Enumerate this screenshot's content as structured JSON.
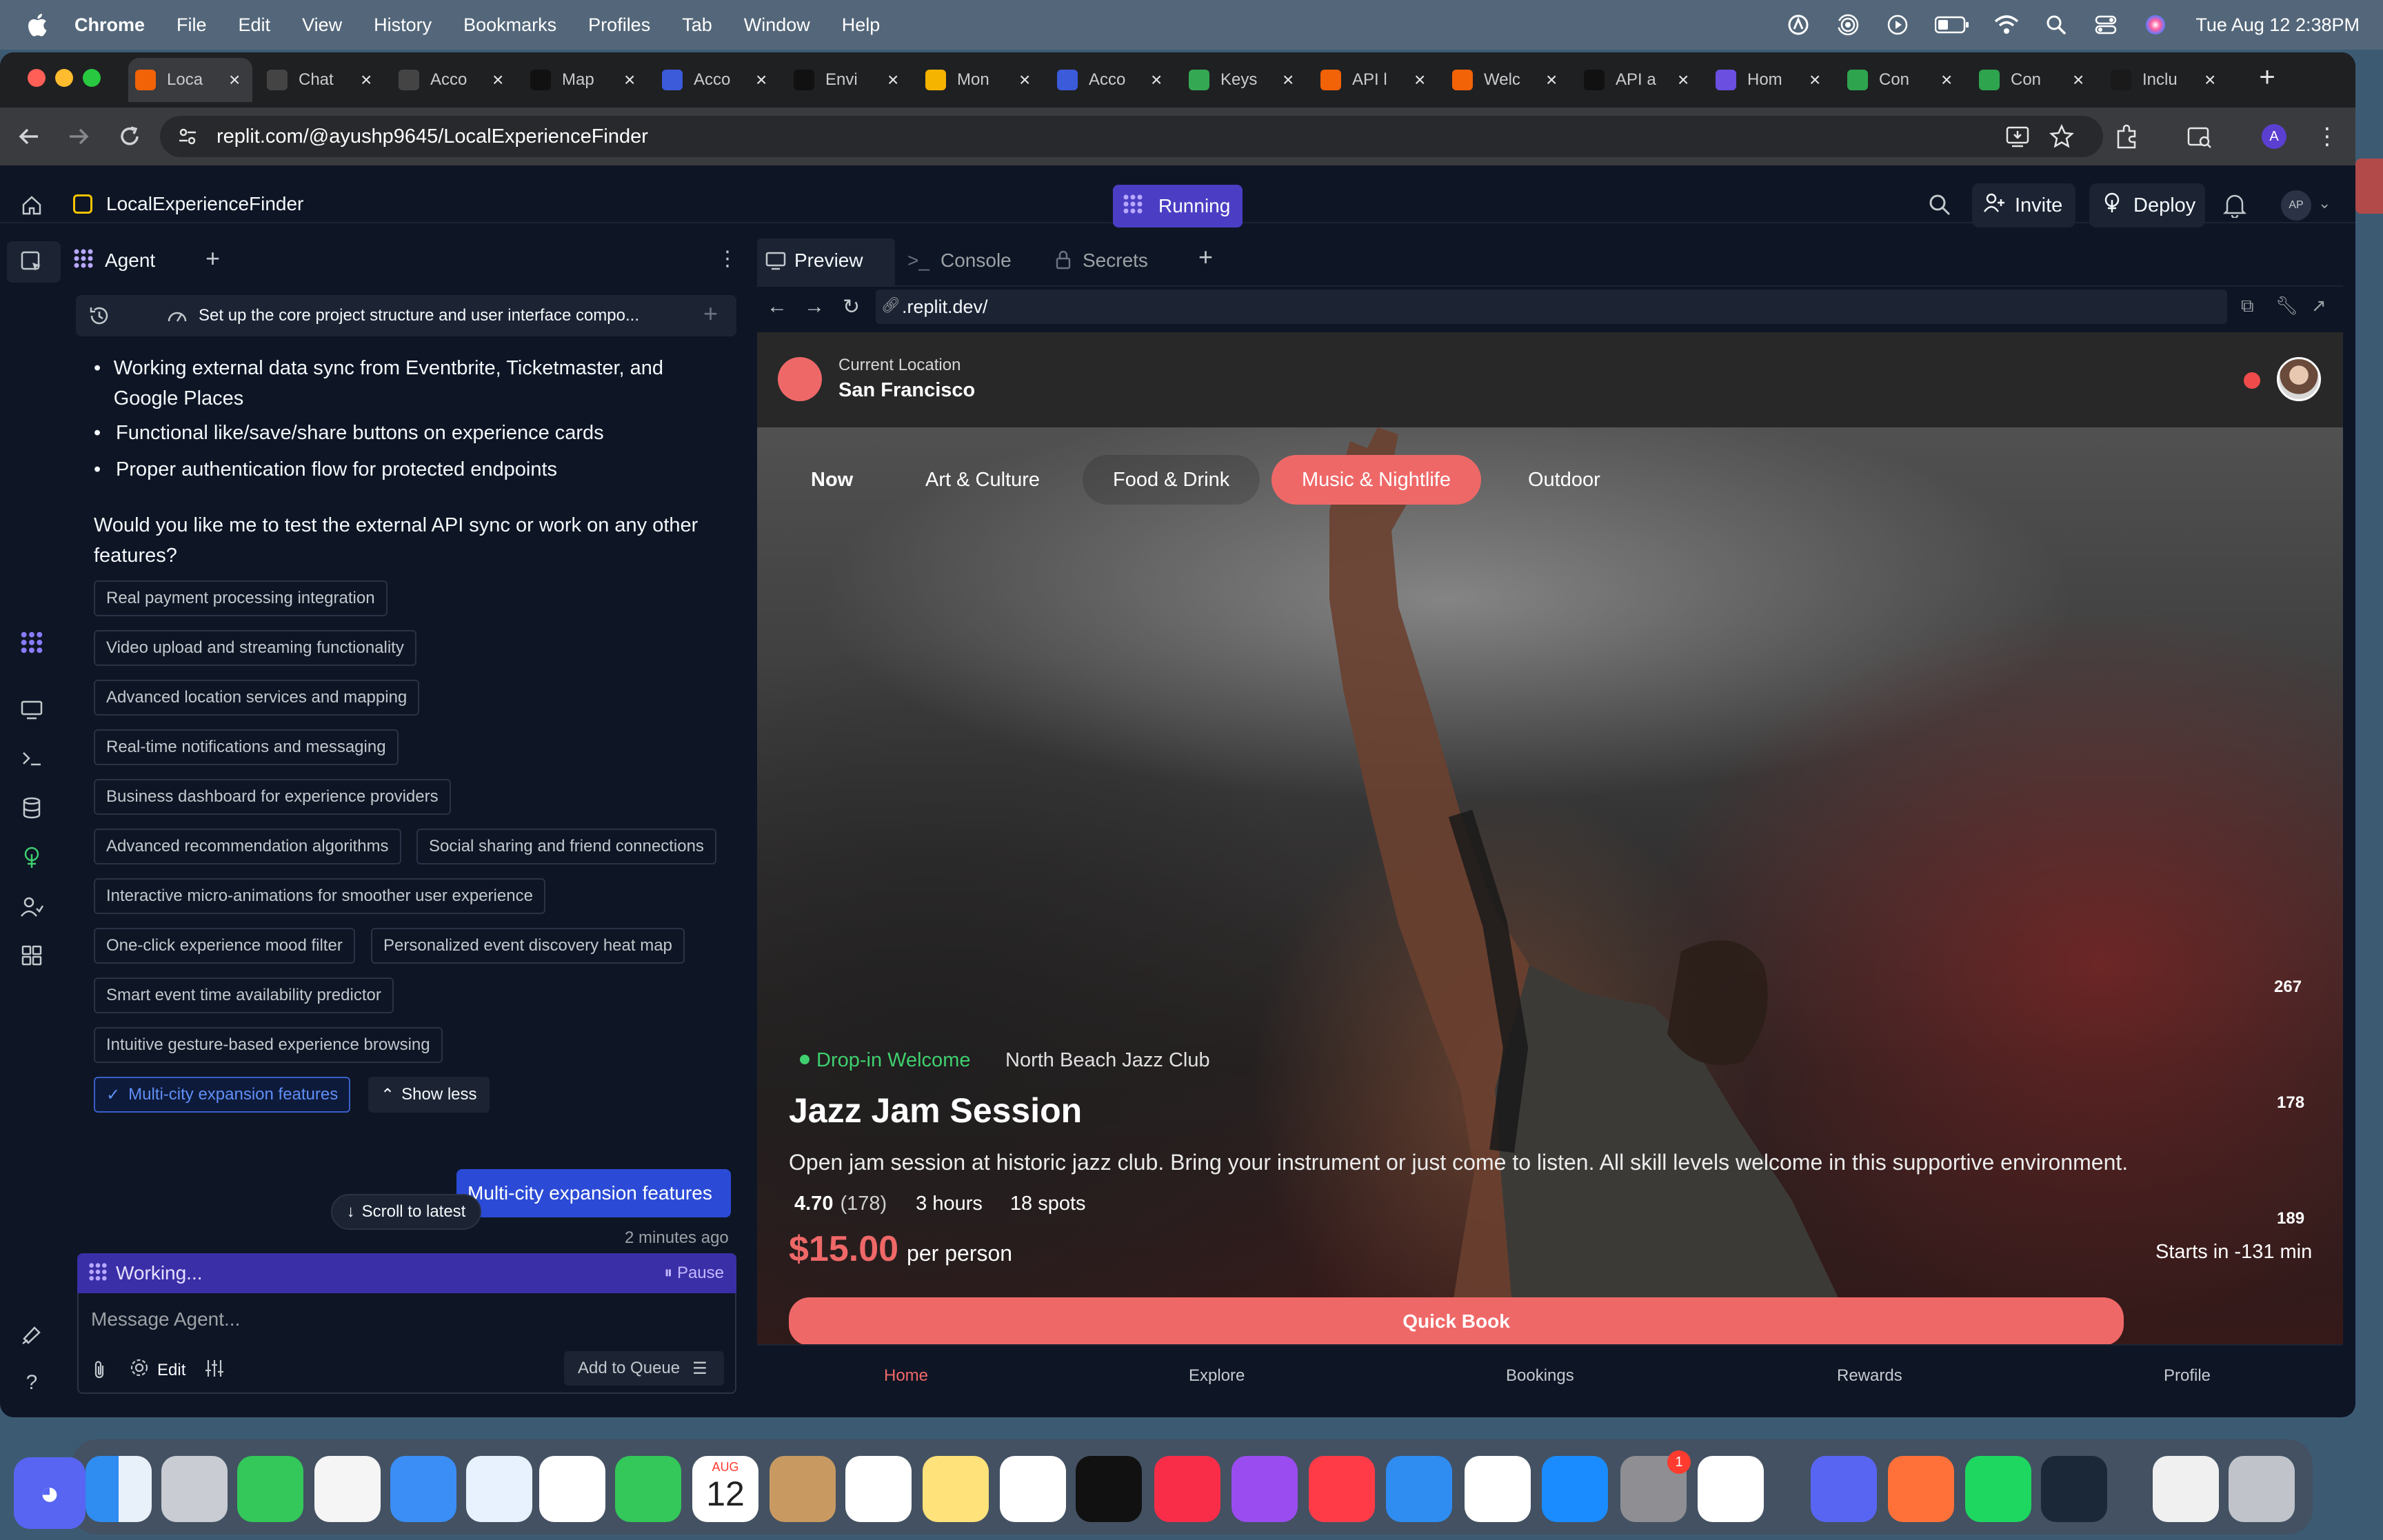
{
  "menubar": {
    "app": "Chrome",
    "items": [
      "File",
      "Edit",
      "View",
      "History",
      "Bookmarks",
      "Profiles",
      "Tab",
      "Window",
      "Help"
    ],
    "clock": "Tue Aug 12  2:38PM"
  },
  "tabs": [
    {
      "label": "Loca",
      "icon": "replit-icon",
      "color": "#f26207"
    },
    {
      "label": "Chat",
      "icon": "openai-icon",
      "color": "#444"
    },
    {
      "label": "Acco",
      "icon": "openai-icon",
      "color": "#444"
    },
    {
      "label": "Map",
      "icon": "map-icon",
      "color": "#111"
    },
    {
      "label": "Acco",
      "icon": "account-icon",
      "color": "#3b5bdb"
    },
    {
      "label": "Envi",
      "icon": "m-icon",
      "color": "#111"
    },
    {
      "label": "Mon",
      "icon": "m-icon",
      "color": "#f5b400"
    },
    {
      "label": "Acco",
      "icon": "account-icon",
      "color": "#3b5bdb"
    },
    {
      "label": "Keys",
      "icon": "maps-pin-icon",
      "color": "#34a853"
    },
    {
      "label": "API l",
      "icon": "replit-icon",
      "color": "#f26207"
    },
    {
      "label": "Welc",
      "icon": "replit-icon",
      "color": "#f26207"
    },
    {
      "label": "API a",
      "icon": "m-icon",
      "color": "#111"
    },
    {
      "label": "Hom",
      "icon": "s-icon",
      "color": "#6b4fe0"
    },
    {
      "label": "Con",
      "icon": "s-icon",
      "color": "#2ea44f"
    },
    {
      "label": "Con",
      "icon": "s-icon",
      "color": "#2ea44f"
    },
    {
      "label": "Inclu",
      "icon": "s-icon",
      "color": "#1a1a1a"
    }
  ],
  "toolbar": {
    "url": "replit.com/@ayushp9645/LocalExperienceFinder",
    "profile_initial": "A"
  },
  "replit": {
    "project_name": "LocalExperienceFinder",
    "run_status": "Running",
    "invite": "Invite",
    "deploy": "Deploy",
    "avatar": "AP"
  },
  "agent": {
    "tab_label": "Agent",
    "history_title": "Set up the core project structure and user interface compo...",
    "bullets": [
      "Working external data sync from Eventbrite, Ticketmaster, and Google Places",
      "Functional like/save/share buttons on experience cards",
      "Proper authentication flow for protected endpoints"
    ],
    "question": "Would you like me to test the external API sync or work on any other features?",
    "suggestions": [
      "Real payment processing integration",
      "Video upload and streaming functionality",
      "Advanced location services and mapping",
      "Real-time notifications and messaging",
      "Business dashboard for experience providers",
      "Advanced recommendation algorithms",
      "Social sharing and friend connections",
      "Interactive micro-animations for smoother user experience",
      "One-click experience mood filter",
      "Personalized event discovery heat map",
      "Smart event time availability predictor",
      "Intuitive gesture-based experience browsing",
      "Multi-city expansion features"
    ],
    "show_less": "Show less",
    "user_message": "Multi-city expansion features",
    "scroll_to_latest": "Scroll to latest",
    "timestamp": "2 minutes ago",
    "working": "Working...",
    "pause": "Pause",
    "input_placeholder": "Message Agent...",
    "edit": "Edit",
    "add_to_queue": "Add to Queue"
  },
  "preview": {
    "tabs": [
      "Preview",
      "Console",
      "Secrets"
    ],
    "url": ".replit.dev/",
    "location_label": "Current Location",
    "location_value": "San Francisco",
    "categories": [
      "Now",
      "Art & Culture",
      "Food & Drink",
      "Music & Nightlife",
      "Outdoor"
    ],
    "active_category": "Music & Nightlife",
    "side_counts": [
      "267",
      "178",
      "189"
    ],
    "badge": "Drop-in Welcome",
    "venue": "North Beach Jazz Club",
    "title": "Jazz Jam Session",
    "description": "Open jam session at historic jazz club. Bring your instrument or just come to listen. All skill levels welcome in this supportive environment.",
    "rating": "4.70",
    "reviews": "(178)",
    "duration": "3 hours",
    "spots": "18 spots",
    "price": "$15.00",
    "price_unit": "per person",
    "starts": "Starts in -131 min",
    "quick_book": "Quick Book",
    "bottom_nav": [
      "Home",
      "Explore",
      "Bookings",
      "Rewards",
      "Profile"
    ]
  },
  "dock": {
    "calendar_month": "AUG",
    "calendar_day": "12",
    "settings_badge": "1"
  },
  "colors": {
    "accent": "#ef6868",
    "replit_purple": "#4b3ec4",
    "badge_green": "#3fcf6f"
  }
}
